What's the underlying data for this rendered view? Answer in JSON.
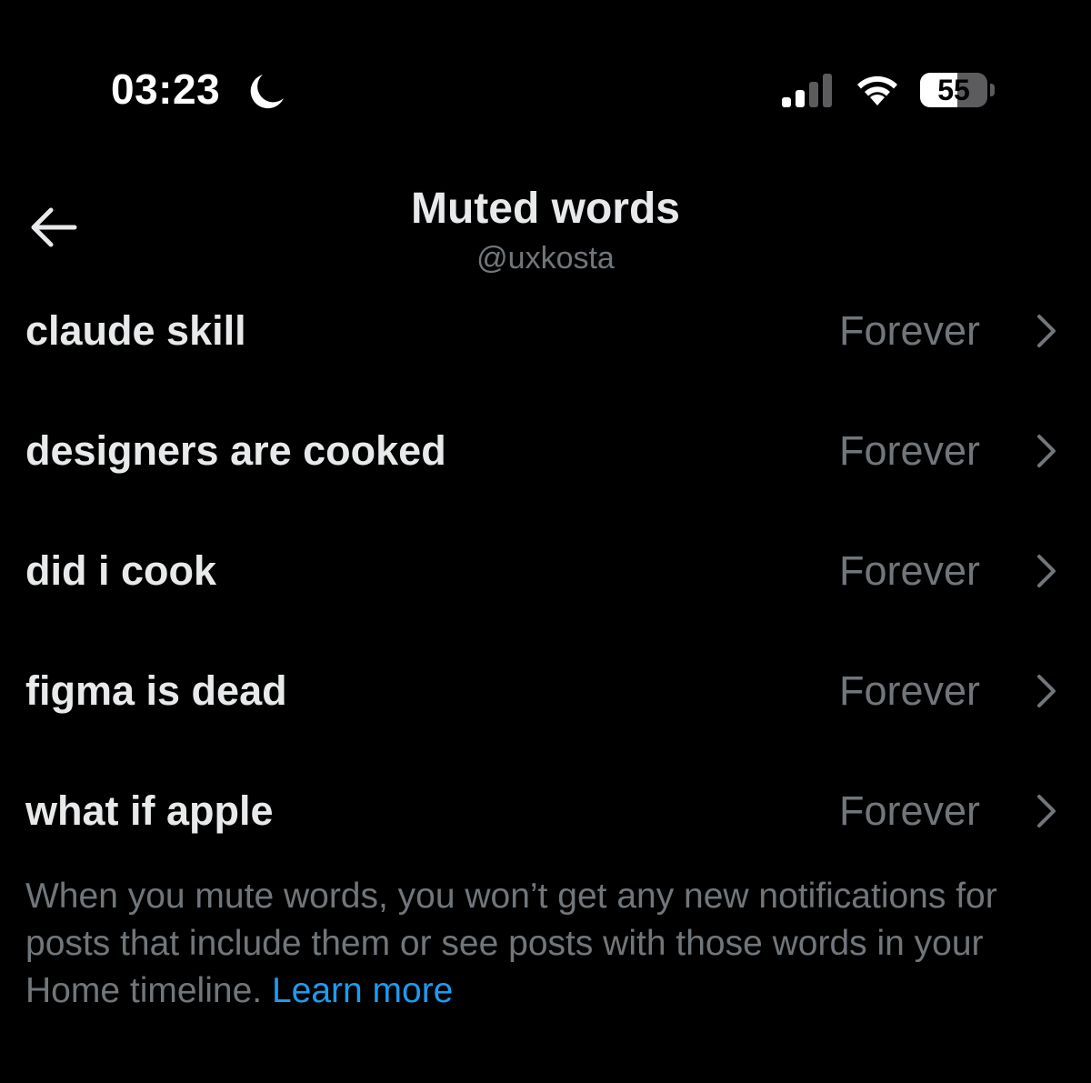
{
  "status_bar": {
    "time": "03:23",
    "battery_level": "55",
    "battery_fraction": 0.55,
    "icons": [
      "moon-icon",
      "signal-icon",
      "wifi-icon",
      "battery-icon"
    ]
  },
  "header": {
    "title": "Muted words",
    "subtitle": "@uxkosta",
    "back_icon": "arrow-left-icon"
  },
  "muted_words": [
    {
      "word": "claude skill",
      "duration": "Forever"
    },
    {
      "word": "designers are cooked",
      "duration": "Forever"
    },
    {
      "word": "did i cook",
      "duration": "Forever"
    },
    {
      "word": "figma is dead",
      "duration": "Forever"
    },
    {
      "word": "what if apple",
      "duration": "Forever"
    }
  ],
  "footer": {
    "note": "When you mute words, you won’t get any new notifications for posts that include them or see posts with those words in your Home timeline.",
    "link_label": "Learn more"
  },
  "colors": {
    "background": "#000000",
    "primary_text": "#e7e9ea",
    "secondary_text": "#71767b",
    "link": "#1d9bf0"
  }
}
